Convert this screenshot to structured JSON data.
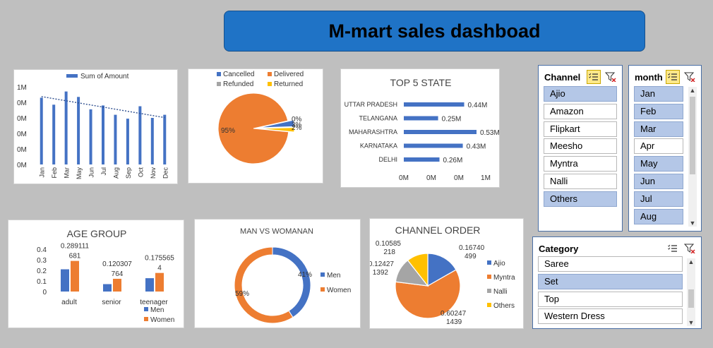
{
  "dashboard_title": "M-mart sales dashboad",
  "chart_data": [
    {
      "type": "bar",
      "id": "monthly",
      "legend": "Sum of Amount",
      "categories": [
        "Jan",
        "Feb",
        "Mar",
        "May",
        "Jun",
        "Jul",
        "Aug",
        "Sep",
        "Oct",
        "Nov",
        "Dec"
      ],
      "values": [
        0.86,
        0.77,
        0.94,
        0.87,
        0.71,
        0.76,
        0.64,
        0.59,
        0.75,
        0.6,
        0.64
      ],
      "y_tick_labels": [
        "1M",
        "0M",
        "0M",
        "0M",
        "0M",
        "0M"
      ],
      "trendline": true,
      "color": "#4472c4"
    },
    {
      "type": "pie",
      "id": "status",
      "labels": [
        "Cancelled",
        "Delivered",
        "Refunded",
        "Returned"
      ],
      "values": [
        3,
        95,
        0,
        2
      ],
      "data_labels": [
        "3%",
        "95%",
        "0%",
        "2%"
      ],
      "colors": [
        "#4472c4",
        "#ed7d31",
        "#a5a5a5",
        "#ffc000"
      ]
    },
    {
      "type": "bar",
      "id": "top5",
      "orientation": "horizontal",
      "title": "TOP 5 STATE",
      "categories": [
        "UTTAR PRADESH",
        "TELANGANA",
        "MAHARASHTRA",
        "KARNATAKA",
        "DELHI"
      ],
      "values": [
        0.44,
        0.25,
        0.53,
        0.43,
        0.26
      ],
      "data_labels": [
        "0.44M",
        "0.25M",
        "0.53M",
        "0.43M",
        "0.26M"
      ],
      "x_tick_labels": [
        "0M",
        "0M",
        "0M",
        "1M"
      ],
      "color": "#4472c4"
    },
    {
      "type": "bar",
      "id": "age",
      "title": "AGE GROUP",
      "categories": [
        "adult",
        "senior",
        "teenager"
      ],
      "series": [
        {
          "name": "Men",
          "values": [
            0.21,
            0.07,
            0.126
          ],
          "color": "#4472c4"
        },
        {
          "name": "Women",
          "values": [
            0.289111681,
            0.120307764,
            0.1755654
          ],
          "color": "#ed7d31"
        }
      ],
      "women_label_lines": [
        [
          "0.289111",
          "681"
        ],
        [
          "0.120307",
          "764"
        ],
        [
          "0.175565",
          "4"
        ]
      ],
      "y_tick_labels": [
        "0.4",
        "0.3",
        "0.2",
        "0.1",
        "0"
      ],
      "ylim": [
        0,
        0.4
      ]
    },
    {
      "type": "pie",
      "id": "gender",
      "donut": true,
      "title": "MAN VS WOMANAN",
      "labels": [
        "Men",
        "Women"
      ],
      "values": [
        41,
        59
      ],
      "data_labels": [
        "41%",
        "59%"
      ],
      "colors": [
        "#4472c4",
        "#ed7d31"
      ]
    },
    {
      "type": "pie",
      "id": "channel",
      "title": "CHANNEL ORDER",
      "labels": [
        "Ajio",
        "Myntra",
        "Nalli",
        "Others"
      ],
      "values": [
        0.16740499,
        0.602471439,
        0.124271392,
        0.10585218
      ],
      "data_label_lines": [
        [
          "0.16740",
          "499"
        ],
        [
          "0.60247",
          "1439"
        ],
        [
          "0.12427",
          "1392"
        ],
        [
          "0.10585",
          "218"
        ]
      ],
      "colors": [
        "#4472c4",
        "#ed7d31",
        "#a5a5a5",
        "#ffc000"
      ]
    }
  ],
  "slicers": {
    "channel": {
      "title": "Channel",
      "items": [
        {
          "label": "Ajio",
          "selected": true
        },
        {
          "label": "Amazon",
          "selected": false
        },
        {
          "label": "Flipkart",
          "selected": false
        },
        {
          "label": "Meesho",
          "selected": false
        },
        {
          "label": "Myntra",
          "selected": false
        },
        {
          "label": "Nalli",
          "selected": false
        },
        {
          "label": "Others",
          "selected": true
        }
      ]
    },
    "month": {
      "title": "month",
      "items": [
        {
          "label": "Jan",
          "selected": true
        },
        {
          "label": "Feb",
          "selected": true
        },
        {
          "label": "Mar",
          "selected": true
        },
        {
          "label": "Apr",
          "selected": false
        },
        {
          "label": "May",
          "selected": true
        },
        {
          "label": "Jun",
          "selected": true
        },
        {
          "label": "Jul",
          "selected": true
        },
        {
          "label": "Aug",
          "selected": true
        }
      ]
    },
    "category": {
      "title": "Category",
      "items": [
        {
          "label": "Saree",
          "selected": false
        },
        {
          "label": "Set",
          "selected": true
        },
        {
          "label": "Top",
          "selected": false
        },
        {
          "label": "Western Dress",
          "selected": false
        }
      ]
    }
  },
  "icons": {
    "multi_select": "multi-select-icon",
    "clear_filter": "clear-filter-icon"
  }
}
